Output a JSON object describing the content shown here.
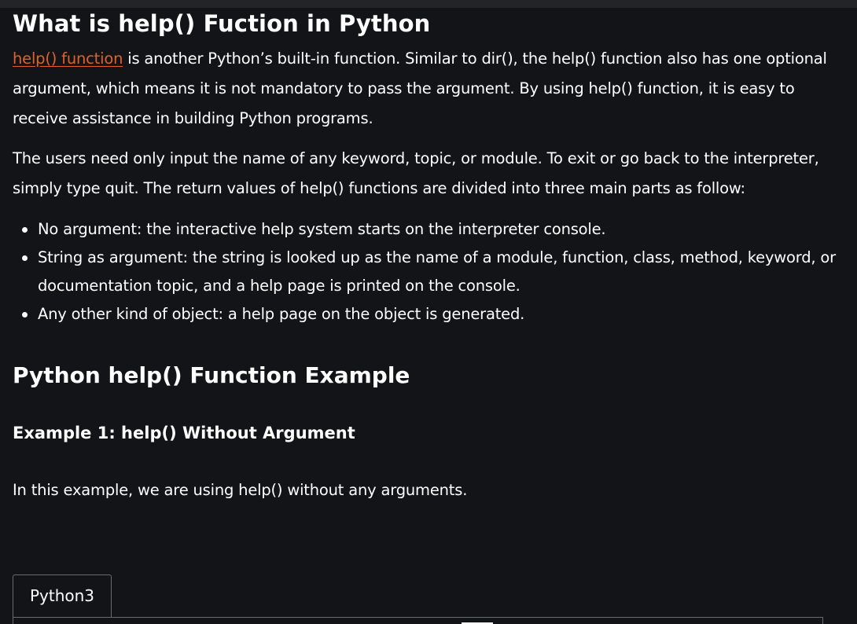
{
  "section1": {
    "title": "What is help() Fuction in Python",
    "para1_link": "help() function",
    "para1_rest": " is another Python’s built-in function. Similar to dir(), the help() function also has one optional argument, which means it is not mandatory to pass the argument. By using help() function, it is easy to receive assistance in building Python programs.",
    "para2": "The users need only input the name of any keyword, topic, or module. To exit or go back to the interpreter, simply type quit. The return values of help() functions are divided into three main parts as follow:",
    "bullets": [
      "No argument: the interactive help system starts on the interpreter console.",
      "String as argument: the string is looked up as the name of a module, function, class, method, keyword, or documentation topic, and a help page is printed on the console.",
      "Any other kind of object: a help page on the object is generated."
    ]
  },
  "section2": {
    "title": "Python help() Function Example",
    "example_title": "Example 1: help() Without Argument",
    "example_intro": "In this example, we are using help() without any arguments.",
    "tab_label": "Python3"
  },
  "colors": {
    "background": "#131417",
    "text": "#ffffff",
    "link": "#e0612a",
    "border": "#6a6b6e"
  }
}
